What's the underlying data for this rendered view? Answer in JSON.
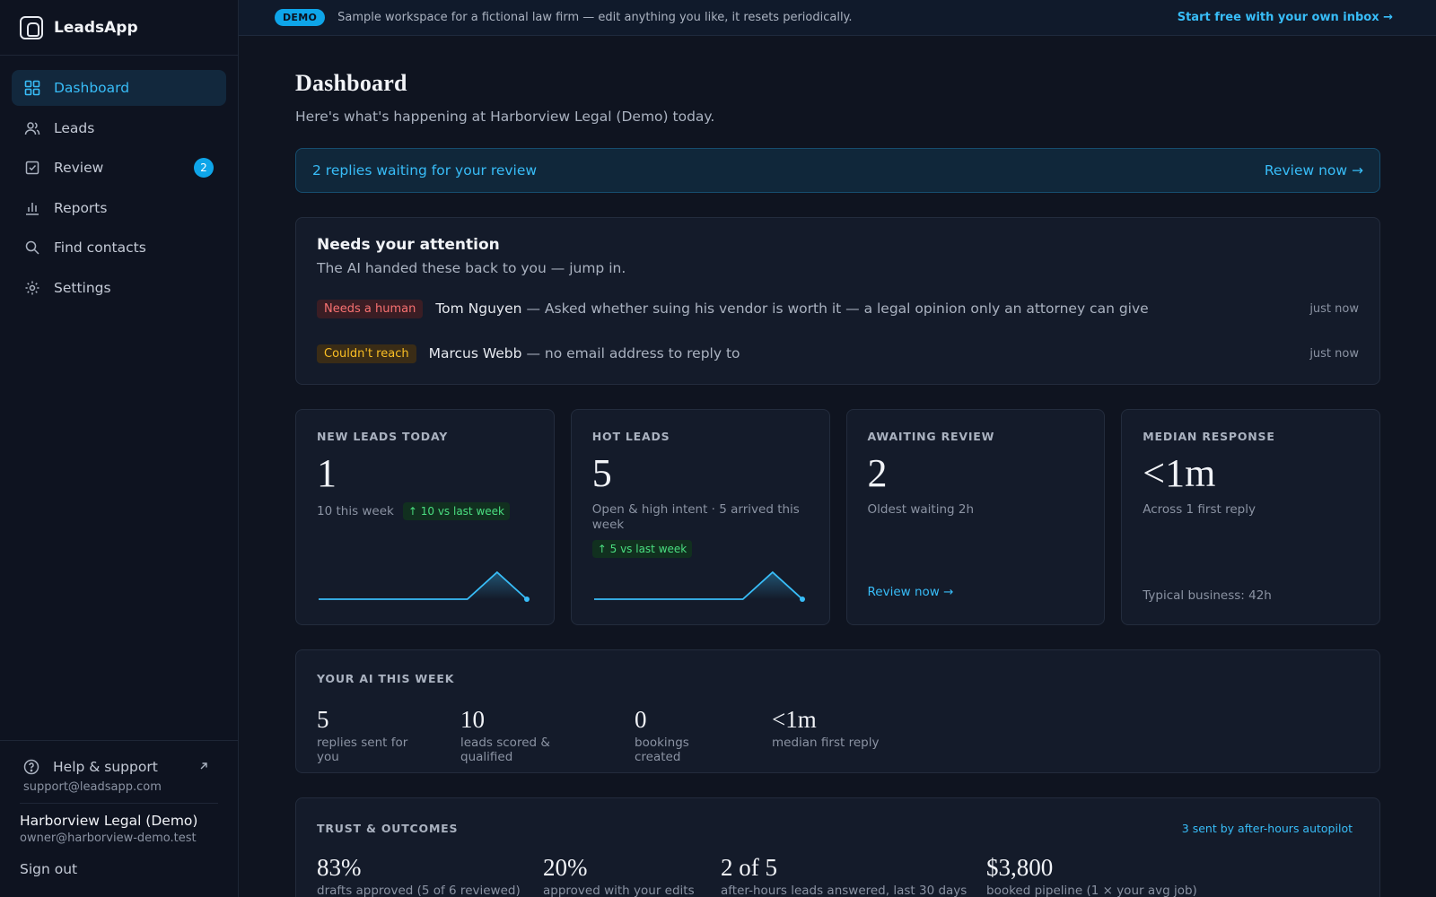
{
  "app": {
    "name": "LeadsApp"
  },
  "sidebar": {
    "items": [
      {
        "label": "Dashboard",
        "icon": "grid-icon",
        "active": true
      },
      {
        "label": "Leads",
        "icon": "users-icon"
      },
      {
        "label": "Review",
        "icon": "check-square-icon",
        "badge": "2"
      },
      {
        "label": "Reports",
        "icon": "bar-chart-icon"
      },
      {
        "label": "Find contacts",
        "icon": "search-icon"
      },
      {
        "label": "Settings",
        "icon": "gear-icon"
      }
    ],
    "help": {
      "label": "Help & support",
      "email": "support@leadsapp.com"
    },
    "account": {
      "name": "Harborview Legal (Demo)",
      "email": "owner@harborview-demo.test"
    },
    "signout": "Sign out"
  },
  "banner": {
    "pill": "DEMO",
    "text": "Sample workspace for a fictional law firm — edit anything you like, it resets periodically.",
    "link": "Start free with your own inbox →"
  },
  "page": {
    "title": "Dashboard",
    "subtitle": "Here's what's happening at Harborview Legal (Demo) today."
  },
  "review_bar": {
    "text": "2 replies waiting for your review",
    "action": "Review now →"
  },
  "attention": {
    "title": "Needs your attention",
    "subtitle": "The AI handed these back to you — jump in.",
    "items": [
      {
        "tag": "Needs a human",
        "name": "Tom Nguyen",
        "desc": "— Asked whether suing his vendor is worth it — a legal opinion only an attorney can give",
        "time": "just now"
      },
      {
        "tag": "Couldn't reach",
        "name": "Marcus Webb",
        "desc": "— no email address to reply to",
        "time": "just now"
      }
    ]
  },
  "stats": {
    "new_leads": {
      "label": "NEW LEADS TODAY",
      "value": "1",
      "sub": "10 this week",
      "delta": "↑ 10 vs last week",
      "spark": [
        0,
        0,
        0,
        0,
        0,
        0,
        1,
        0
      ]
    },
    "hot_leads": {
      "label": "HOT LEADS",
      "value": "5",
      "sub": "Open & high intent · 5 arrived this week",
      "delta": "↑ 5 vs last week",
      "spark": [
        0,
        0,
        0,
        0,
        0,
        0,
        1,
        0
      ]
    },
    "awaiting": {
      "label": "AWAITING REVIEW",
      "value": "2",
      "sub": "Oldest waiting 2h",
      "link": "Review now →"
    },
    "median": {
      "label": "MEDIAN RESPONSE",
      "value": "<1m",
      "sub": "Across 1 first reply",
      "foot": "Typical business: 42h"
    }
  },
  "ai_week": {
    "label": "YOUR AI THIS WEEK",
    "metrics": [
      {
        "value": "5",
        "label": "replies sent for you"
      },
      {
        "value": "10",
        "label": "leads scored & qualified"
      },
      {
        "value": "0",
        "label": "bookings created"
      },
      {
        "value": "<1m",
        "label": "median first reply"
      }
    ]
  },
  "trust": {
    "label": "TRUST & OUTCOMES",
    "link": "3 sent by after-hours autopilot",
    "metrics": [
      {
        "value": "83%",
        "label": "drafts approved (5 of 6 reviewed)"
      },
      {
        "value": "20%",
        "label": "approved with your edits"
      },
      {
        "value": "2 of 5",
        "label": "after-hours leads answered, last 30 days"
      },
      {
        "value": "$3,800",
        "label": "booked pipeline (1 × your avg job)"
      }
    ]
  },
  "colors": {
    "accent": "#38bdf8",
    "background": "#0f1420",
    "card": "#141b2a",
    "success": "#4ade80",
    "danger": "#f87171",
    "warning": "#fbbf24"
  }
}
